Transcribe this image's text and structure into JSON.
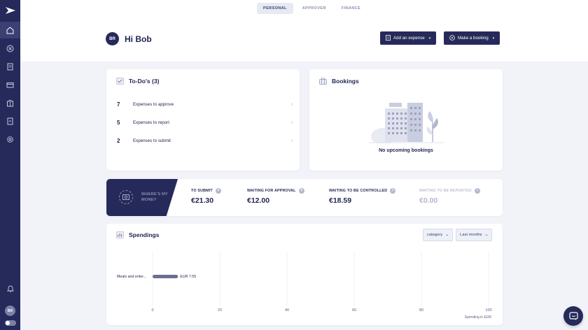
{
  "sidebar": {
    "icons": [
      "home-icon",
      "receipt-icon",
      "document-icon",
      "card-icon",
      "suitcase-icon",
      "report-icon",
      "settings-icon"
    ],
    "user_initials": "BR"
  },
  "header": {
    "tabs": [
      {
        "label": "PERSONAL",
        "active": true
      },
      {
        "label": "APPROVER",
        "active": false
      },
      {
        "label": "FINANCE",
        "active": false
      }
    ],
    "avatar_initials": "BR",
    "greeting": "Hi Bob",
    "add_expense_label": "Add an expense",
    "make_booking_label": "Make a booking"
  },
  "todos": {
    "title": "To-Do's (3)",
    "items": [
      {
        "count": "7",
        "label": "Expenses to approve"
      },
      {
        "count": "5",
        "label": "Expenses to report"
      },
      {
        "count": "2",
        "label": "Expenses to submit"
      }
    ]
  },
  "bookings": {
    "title": "Bookings",
    "empty_text": "No upcoming bookings"
  },
  "money": {
    "banner_line1": "WHERE'S MY",
    "banner_line2": "MONEY",
    "columns": [
      {
        "label": "TO SUBMIT",
        "value": "€21.30",
        "muted": false
      },
      {
        "label": "WAITING FOR APPROVAL",
        "value": "€12.00",
        "muted": false
      },
      {
        "label": "WAITING TO BE CONTROLLED",
        "value": "€18.59",
        "muted": false
      },
      {
        "label": "WAITING TO BE REPORTED",
        "value": "€0.00",
        "muted": true
      }
    ]
  },
  "spendings": {
    "title": "Spendings",
    "filter_category": "category",
    "filter_period": "Last months"
  },
  "chart_data": {
    "type": "bar",
    "orientation": "horizontal",
    "categories": [
      "Meals and enter..."
    ],
    "values": [
      7.55
    ],
    "data_labels": [
      "EUR 7.55"
    ],
    "xlabel": "Spending in EUR",
    "xlim": [
      0,
      100
    ],
    "xticks": [
      0,
      20,
      40,
      60,
      80,
      100
    ],
    "grid": true,
    "bar_color": "#6b6f93"
  }
}
